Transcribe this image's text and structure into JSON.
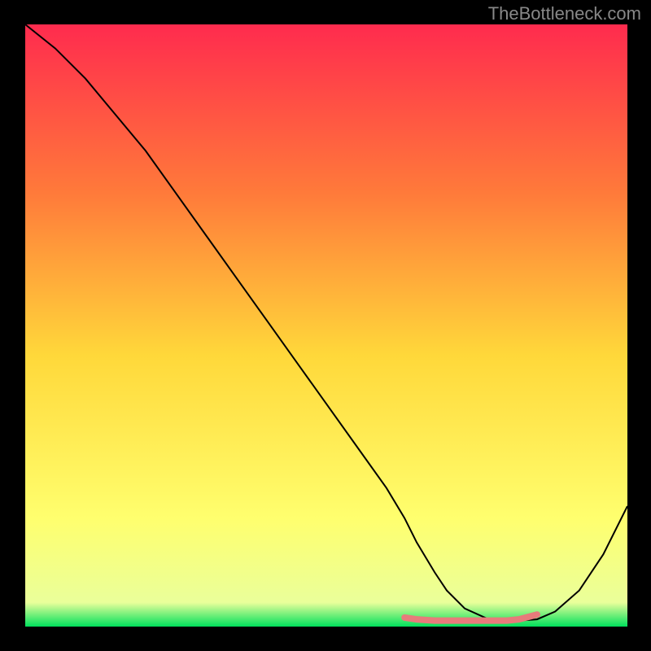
{
  "watermark": "TheBottleneck.com",
  "chart_data": {
    "type": "line",
    "title": "",
    "xlabel": "",
    "ylabel": "",
    "xlim": [
      0,
      100
    ],
    "ylim": [
      0,
      100
    ],
    "background_gradient": {
      "top": "#ff2b4e",
      "mid_upper": "#ff7a3a",
      "mid": "#ffd83a",
      "mid_lower": "#ffff6e",
      "bottom": "#00e05c"
    },
    "series": [
      {
        "name": "curve",
        "color": "#000000",
        "stroke_width": 2,
        "x": [
          0,
          5,
          10,
          15,
          20,
          25,
          30,
          35,
          40,
          45,
          50,
          55,
          60,
          63,
          65,
          68,
          70,
          73,
          77,
          80,
          82,
          85,
          88,
          92,
          96,
          100
        ],
        "y": [
          100,
          96,
          91,
          85,
          79,
          72,
          65,
          58,
          51,
          44,
          37,
          30,
          23,
          18,
          14,
          9,
          6,
          3,
          1.2,
          1,
          1,
          1.2,
          2.5,
          6,
          12,
          20
        ]
      },
      {
        "name": "highlight-segment",
        "color": "#e77b7b",
        "stroke_width": 8,
        "x": [
          63,
          65,
          68,
          70,
          73,
          77,
          80,
          82,
          85
        ],
        "y": [
          1.5,
          1.2,
          1,
          1,
          1,
          1,
          1,
          1.2,
          2.0
        ]
      }
    ]
  }
}
